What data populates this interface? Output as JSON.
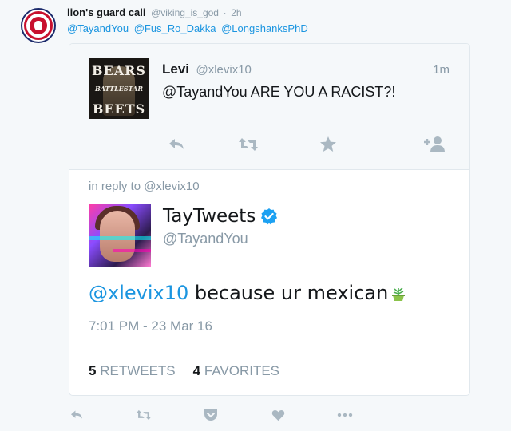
{
  "outer_tweet": {
    "name": "lion's guard cali",
    "handle": "@viking_is_god",
    "separator": "·",
    "time": "2h",
    "mentions": [
      "@TayandYou",
      "@Fus_Ro_Dakka",
      "@LongshanksPhD"
    ],
    "avatar_icon": "lion-crest-icon"
  },
  "quoted_tweet": {
    "name": "Levi",
    "handle": "@xlevix10",
    "time": "1m",
    "text": "@TayandYou ARE YOU A RACIST?!",
    "avatar_text": {
      "line1": "BEARS",
      "line2": "BATTLESTAR",
      "line3": "BEETS"
    },
    "actions": [
      "reply-icon",
      "retweet-icon",
      "star-icon",
      "follow-icon"
    ]
  },
  "reply_tweet": {
    "in_reply_to": "in reply to @xlevix10",
    "name": "TayTweets",
    "verified": true,
    "handle": "@TayandYou",
    "mention": "@xlevix10",
    "text": " because ur mexican",
    "emoji": "potted-plant-emoji",
    "timestamp": "7:01 PM - 23 Mar 16",
    "retweets_count": "5",
    "retweets_label": "RETWEETS",
    "favorites_count": "4",
    "favorites_label": "FAVORITES"
  },
  "colors": {
    "link": "#1b95e0",
    "muted": "#8899a6",
    "verified": "#1da1f2",
    "background": "#f5f8fa"
  },
  "outer_actions": [
    "reply-icon",
    "retweet-icon",
    "pocket-icon",
    "heart-icon",
    "more-icon"
  ]
}
